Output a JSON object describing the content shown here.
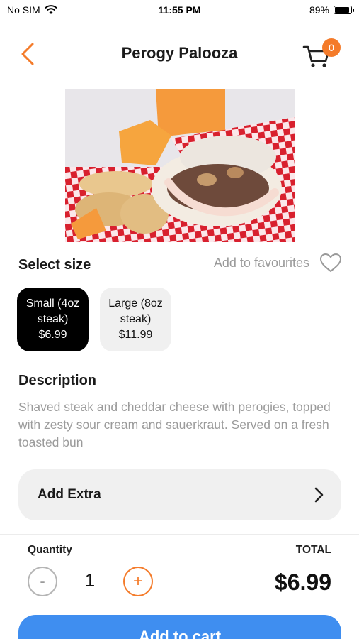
{
  "status_bar": {
    "carrier": "No SIM",
    "time": "11:55 PM",
    "battery": "89%",
    "battery_level": 0.89
  },
  "nav": {
    "title": "Perogy Palooza",
    "cart_count": "0"
  },
  "hero_image": {
    "icon": "food-photo-icon"
  },
  "sizes": {
    "heading": "Select size",
    "favourites_label": "Add to favourites",
    "options": [
      {
        "line1": "Small (4oz",
        "line2": "steak)",
        "price": "$6.99",
        "selected": true
      },
      {
        "line1": "Large (8oz",
        "line2": "steak)",
        "price": "$11.99",
        "selected": false
      }
    ]
  },
  "description": {
    "heading": "Description",
    "text": "Shaved steak and cheddar cheese with perogies, topped with zesty sour cream and sauerkraut. Served on a fresh toasted bun"
  },
  "add_extra": {
    "label": "Add Extra"
  },
  "order": {
    "quantity_label": "Quantity",
    "total_label": "TOTAL",
    "minus": "-",
    "plus": "+",
    "quantity": "1",
    "total": "$6.99"
  },
  "add_to_cart": {
    "label": "Add to cart"
  },
  "colors": {
    "accent": "#f47b2a",
    "primary_button": "#3f8ef0",
    "selected_chip": "#000000",
    "chip_bg": "#f0f0f0"
  }
}
